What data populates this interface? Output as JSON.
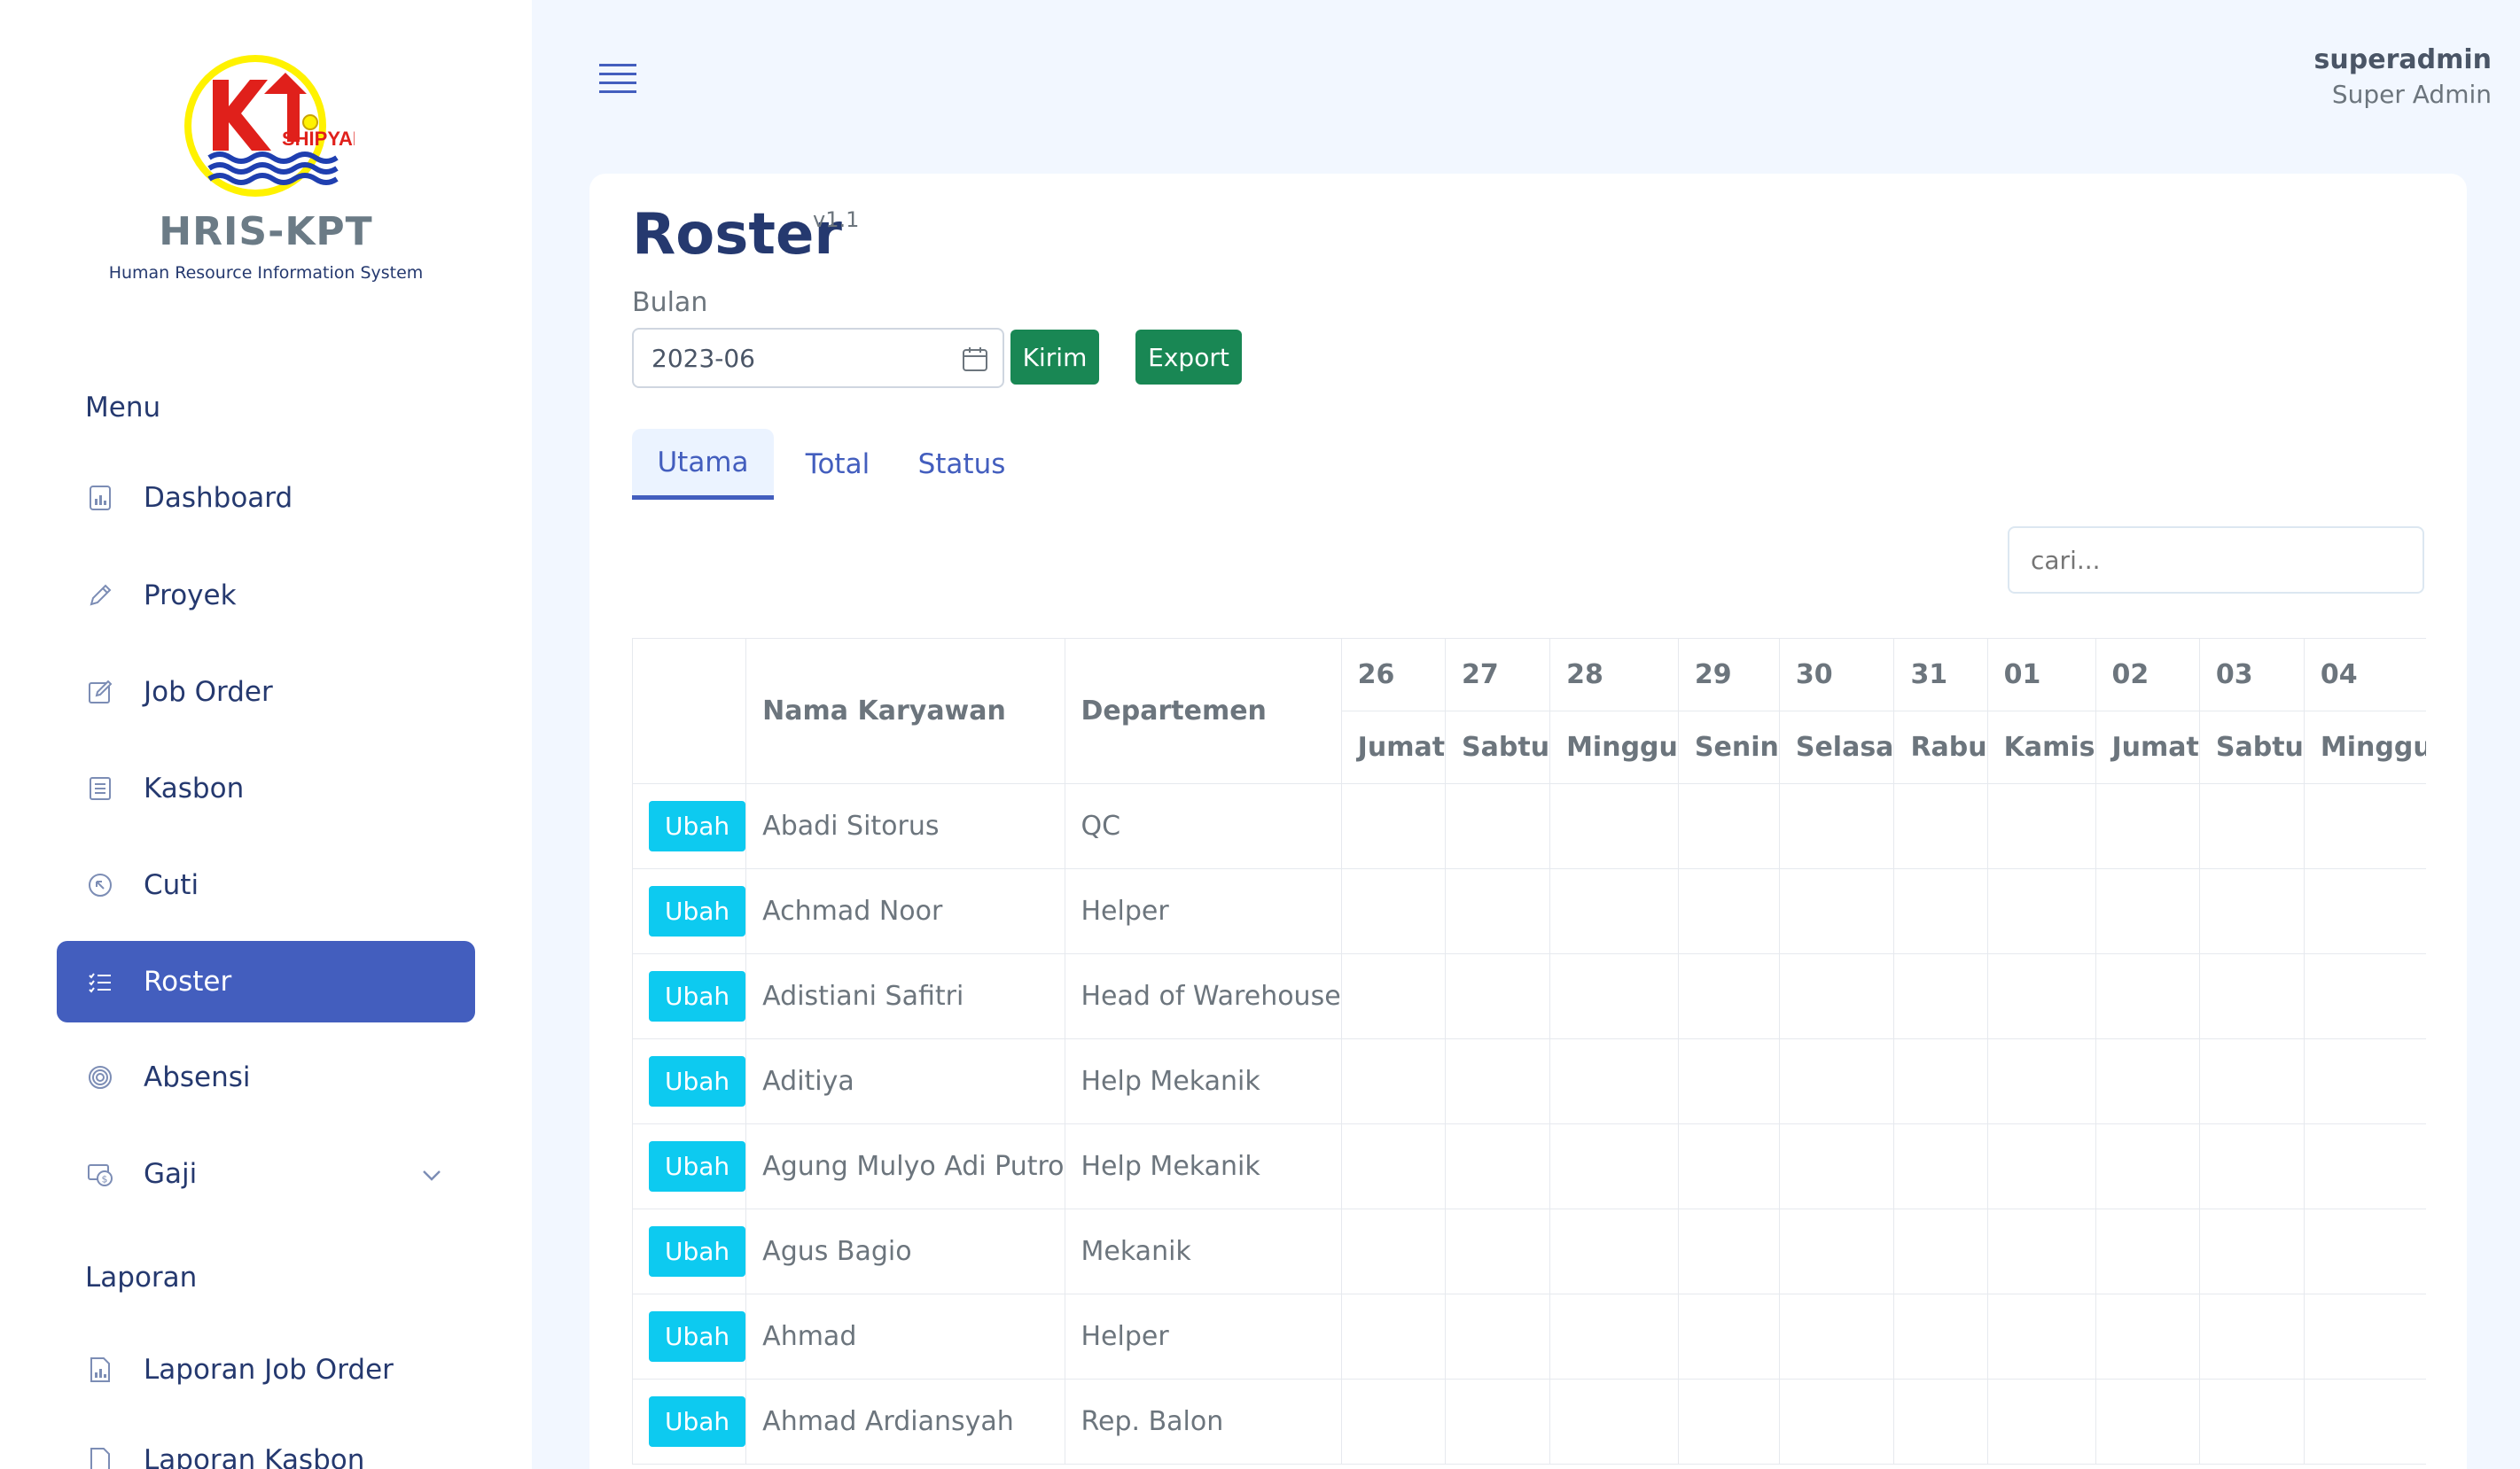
{
  "sidebar": {
    "app_name": "HRIS-KPT",
    "app_subtitle": "Human Resource Information System",
    "logo_text": "SHIPYARD",
    "menu_title": "Menu",
    "items": [
      {
        "label": "Dashboard",
        "icon": "chart-icon"
      },
      {
        "label": "Proyek",
        "icon": "pencil-icon"
      },
      {
        "label": "Job Order",
        "icon": "edit-icon"
      },
      {
        "label": "Kasbon",
        "icon": "list-icon"
      },
      {
        "label": "Cuti",
        "icon": "arrow-circle-icon"
      },
      {
        "label": "Roster",
        "icon": "list-check-icon",
        "active": true
      },
      {
        "label": "Absensi",
        "icon": "fingerprint-icon"
      },
      {
        "label": "Gaji",
        "icon": "cash-icon"
      }
    ],
    "report_title": "Laporan",
    "report_items": [
      {
        "label": "Laporan Job Order"
      },
      {
        "label": "Laporan Kasbon"
      }
    ]
  },
  "header": {
    "user_name": "superadmin",
    "user_role": "Super Admin"
  },
  "page": {
    "title": "Roster",
    "version": "v1.1",
    "month_label": "Bulan",
    "month_value": "2023-06",
    "send_button": "Kirim",
    "export_button": "Export",
    "tabs": [
      "Utama",
      "Total",
      "Status"
    ],
    "search_placeholder": "cari..."
  },
  "table": {
    "col_name": "Nama Karyawan",
    "col_dept": "Departemen",
    "dates": [
      "26",
      "27",
      "28",
      "29",
      "30",
      "31",
      "01",
      "02",
      "03",
      "04"
    ],
    "days": [
      "Jumat",
      "Sabtu",
      "Minggu",
      "Senin",
      "Selasa",
      "Rabu",
      "Kamis",
      "Jumat",
      "Sabtu",
      "Minggu"
    ],
    "edit_label": "Ubah",
    "rows": [
      {
        "name": "Abadi Sitorus",
        "dept": "QC"
      },
      {
        "name": "Achmad Noor",
        "dept": "Helper"
      },
      {
        "name": "Adistiani Safitri",
        "dept": "Head of Warehouse"
      },
      {
        "name": "Aditiya",
        "dept": "Help Mekanik"
      },
      {
        "name": "Agung Mulyo Adi Putro",
        "dept": "Help Mekanik"
      },
      {
        "name": "Agus Bagio",
        "dept": "Mekanik"
      },
      {
        "name": "Ahmad",
        "dept": "Helper"
      },
      {
        "name": "Ahmad Ardiansyah",
        "dept": "Rep. Balon"
      }
    ]
  },
  "colors": {
    "primary": "#435ebe",
    "success": "#198754",
    "info": "#0dcaf0",
    "background": "#f2f7ff"
  }
}
